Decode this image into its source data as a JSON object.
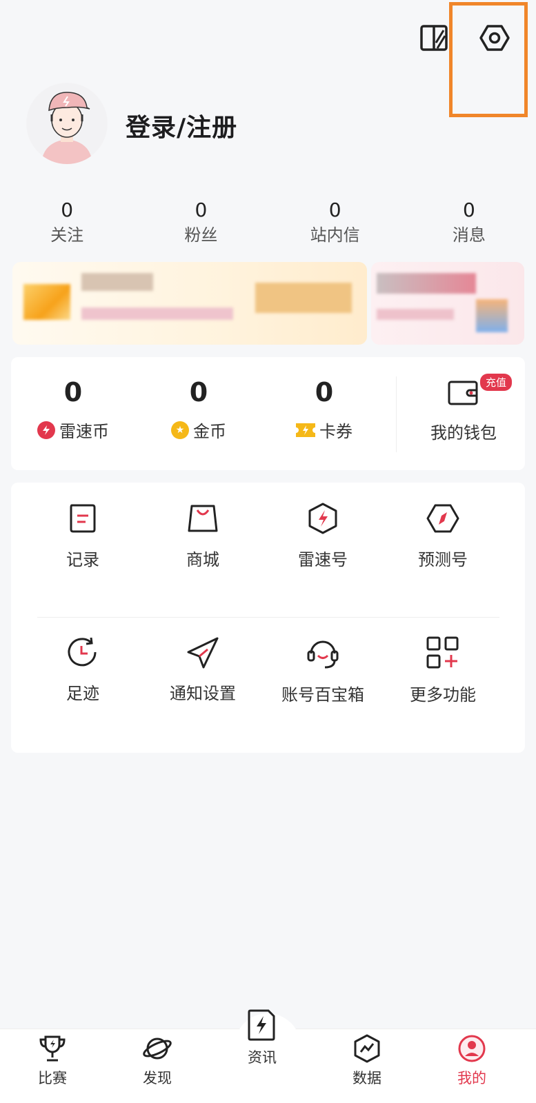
{
  "header": {
    "skin_icon": "skin-theme-icon",
    "settings_icon": "settings-hexagon-icon"
  },
  "profile": {
    "login_label": "登录/注册",
    "avatar": "avatar-illustration"
  },
  "stats": [
    {
      "value": "0",
      "label": "关注"
    },
    {
      "value": "0",
      "label": "粉丝"
    },
    {
      "value": "0",
      "label": "站内信"
    },
    {
      "value": "0",
      "label": "消息"
    }
  ],
  "wallet": {
    "items": [
      {
        "value": "0",
        "label": "雷速币",
        "icon": "lightning-coin-icon"
      },
      {
        "value": "0",
        "label": "金币",
        "icon": "star-coin-icon"
      },
      {
        "value": "0",
        "label": "卡券",
        "icon": "ticket-icon"
      }
    ],
    "wallet_label": "我的钱包",
    "recharge_badge": "充值"
  },
  "features": [
    {
      "label": "记录",
      "icon": "record-icon"
    },
    {
      "label": "商城",
      "icon": "shop-bag-icon"
    },
    {
      "label": "雷速号",
      "icon": "leisu-account-icon"
    },
    {
      "label": "预测号",
      "icon": "compass-icon"
    },
    {
      "label": "足迹",
      "icon": "history-icon"
    },
    {
      "label": "通知设置",
      "icon": "paper-plane-icon"
    },
    {
      "label": "账号百宝箱",
      "icon": "headset-icon"
    },
    {
      "label": "更多功能",
      "icon": "more-grid-icon"
    }
  ],
  "nav": [
    {
      "label": "比赛",
      "icon": "trophy-icon"
    },
    {
      "label": "发现",
      "icon": "planet-icon"
    },
    {
      "label": "资讯",
      "icon": "news-lightning-icon"
    },
    {
      "label": "数据",
      "icon": "data-chart-icon"
    },
    {
      "label": "我的",
      "icon": "profile-icon"
    }
  ],
  "colors": {
    "accent": "#e2384d",
    "highlight": "#f0862a",
    "gold": "#f5b818",
    "background": "#f6f7f9"
  }
}
